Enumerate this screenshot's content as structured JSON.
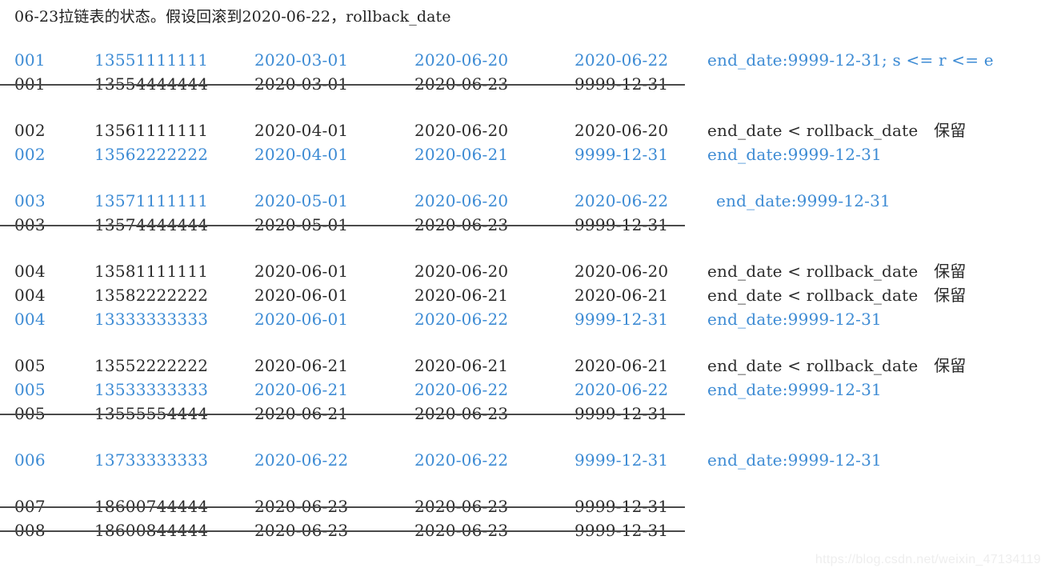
{
  "caption": "06-23拉链表的状态。假设回滚到2020-06-22，rollback_date",
  "colors": {
    "blue": "#3d8bd4",
    "black": "#2b2b2b",
    "strike": "#4a4a4a",
    "watermark": "#eeeeee",
    "background": "#ffffff"
  },
  "watermark": "https://blog.csdn.net/weixin_47134119",
  "groups": [
    {
      "rows": [
        {
          "id": "001",
          "phone": "13551111111",
          "start_date": "2020-03-01",
          "mod_date": "2020-06-20",
          "end_date": "2020-06-22",
          "note": "end_date:9999-12-31; s <= r <= e",
          "color": "blue",
          "struck": false,
          "note_indent": false
        },
        {
          "id": "001",
          "phone": "13554444444",
          "start_date": "2020-03-01",
          "mod_date": "2020-06-23",
          "end_date": "9999-12-31",
          "note": "",
          "color": "black",
          "struck": true,
          "note_indent": false
        }
      ]
    },
    {
      "rows": [
        {
          "id": "002",
          "phone": "13561111111",
          "start_date": "2020-04-01",
          "mod_date": "2020-06-20",
          "end_date": "2020-06-20",
          "note": "end_date < rollback_date   保留",
          "color": "black",
          "struck": false,
          "note_indent": false
        },
        {
          "id": "002",
          "phone": "13562222222",
          "start_date": "2020-04-01",
          "mod_date": "2020-06-21",
          "end_date": "9999-12-31",
          "note": "end_date:9999-12-31",
          "color": "blue",
          "struck": false,
          "note_indent": false
        }
      ]
    },
    {
      "rows": [
        {
          "id": "003",
          "phone": "13571111111",
          "start_date": "2020-05-01",
          "mod_date": "2020-06-20",
          "end_date": "2020-06-22",
          "note": "end_date:9999-12-31",
          "color": "blue",
          "struck": false,
          "note_indent": true
        },
        {
          "id": "003",
          "phone": "13574444444",
          "start_date": "2020-05-01",
          "mod_date": "2020-06-23",
          "end_date": "9999-12-31",
          "note": "",
          "color": "black",
          "struck": true,
          "note_indent": false
        }
      ]
    },
    {
      "rows": [
        {
          "id": "004",
          "phone": "13581111111",
          "start_date": "2020-06-01",
          "mod_date": "2020-06-20",
          "end_date": "2020-06-20",
          "note": "end_date < rollback_date   保留",
          "color": "black",
          "struck": false,
          "note_indent": false
        },
        {
          "id": "004",
          "phone": "13582222222",
          "start_date": "2020-06-01",
          "mod_date": "2020-06-21",
          "end_date": "2020-06-21",
          "note": "end_date < rollback_date   保留",
          "color": "black",
          "struck": false,
          "note_indent": false
        },
        {
          "id": "004",
          "phone": "13333333333",
          "start_date": "2020-06-01",
          "mod_date": "2020-06-22",
          "end_date": "9999-12-31",
          "note": "end_date:9999-12-31",
          "color": "blue",
          "struck": false,
          "note_indent": false
        }
      ]
    },
    {
      "rows": [
        {
          "id": "005",
          "phone": "13552222222",
          "start_date": "2020-06-21",
          "mod_date": "2020-06-21",
          "end_date": "2020-06-21",
          "note": "end_date < rollback_date   保留",
          "color": "black",
          "struck": false,
          "note_indent": false
        },
        {
          "id": "005",
          "phone": "13533333333",
          "start_date": "2020-06-21",
          "mod_date": "2020-06-22",
          "end_date": "2020-06-22",
          "note": "end_date:9999-12-31",
          "color": "blue",
          "struck": false,
          "note_indent": false
        },
        {
          "id": "005",
          "phone": "13555554444",
          "start_date": "2020-06-21",
          "mod_date": "2020-06-23",
          "end_date": "9999-12-31",
          "note": "",
          "color": "black",
          "struck": true,
          "note_indent": false
        }
      ]
    },
    {
      "rows": [
        {
          "id": "006",
          "phone": "13733333333",
          "start_date": "2020-06-22",
          "mod_date": "2020-06-22",
          "end_date": "9999-12-31",
          "note": "end_date:9999-12-31",
          "color": "blue",
          "struck": false,
          "note_indent": false
        }
      ]
    },
    {
      "rows": [
        {
          "id": "007",
          "phone": "18600744444",
          "start_date": "2020-06-23",
          "mod_date": "2020-06-23",
          "end_date": "9999-12-31",
          "note": "",
          "color": "black",
          "struck": true,
          "note_indent": false
        },
        {
          "id": "008",
          "phone": "18600844444",
          "start_date": "2020-06-23",
          "mod_date": "2020-06-23",
          "end_date": "9999-12-31",
          "note": "",
          "color": "black",
          "struck": true,
          "note_indent": false
        }
      ]
    }
  ]
}
